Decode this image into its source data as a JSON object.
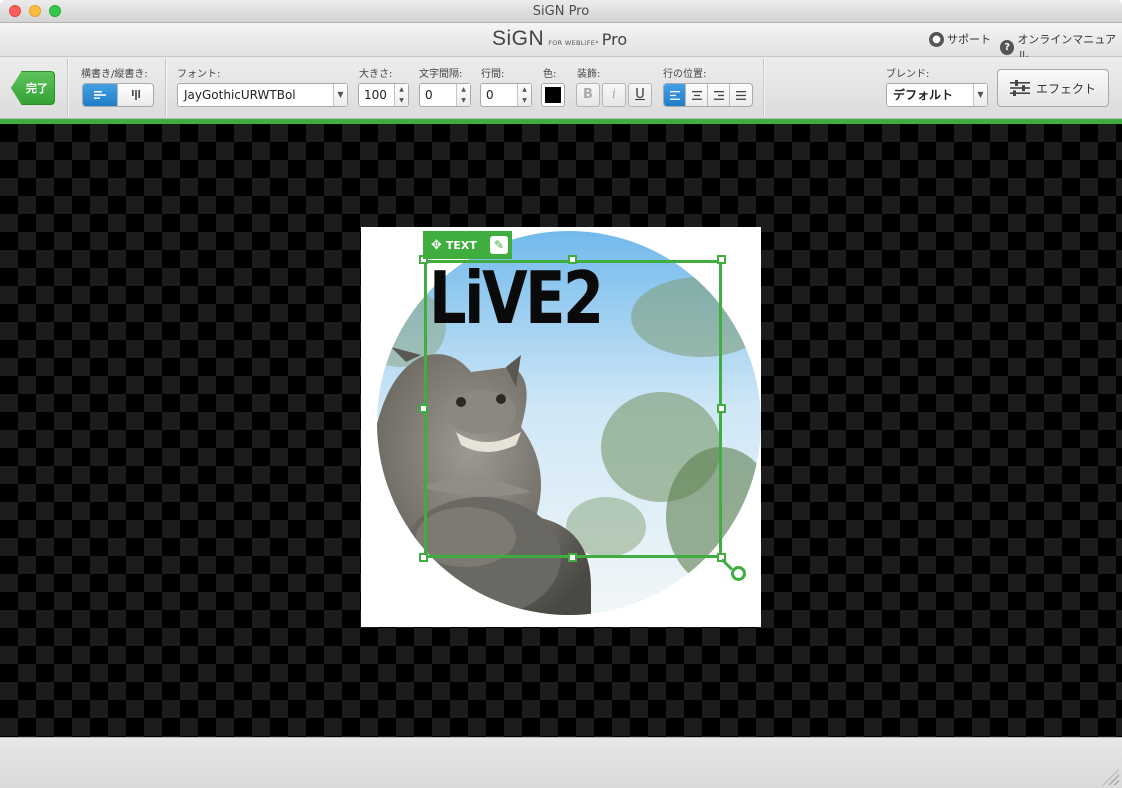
{
  "window": {
    "title": "SiGN Pro"
  },
  "brand": {
    "name": "SiGN",
    "subtitle": "FOR WEBLiFE*",
    "edition": "Pro"
  },
  "header_links": {
    "support": "サポート",
    "manual": "オンラインマニュアル"
  },
  "toolbar": {
    "done_label": "完了",
    "orientation_label": "横書き/縦書き:",
    "orientation_options": [
      "horizontal",
      "vertical"
    ],
    "orientation_selected": "horizontal",
    "font_label": "フォント:",
    "font_value": "JayGothicURWTBol",
    "size_label": "大きさ:",
    "size_value": "100",
    "char_spacing_label": "文字間隔:",
    "char_spacing_value": "0",
    "line_spacing_label": "行間:",
    "line_spacing_value": "0",
    "color_label": "色:",
    "color_value": "#000000",
    "decoration_label": "装飾:",
    "decoration_bold": "B",
    "decoration_italic": "i",
    "decoration_underline": "U",
    "align_label": "行の位置:",
    "align_selected": "left",
    "blend_label": "ブレンド:",
    "blend_value": "デフォルト",
    "effect_label": "エフェクト"
  },
  "canvas": {
    "text_tag_label": "TEXT",
    "text_content": "LiVE2",
    "accent_color": "#3fae3f",
    "background_image": "shisa-statue-in-circle"
  }
}
